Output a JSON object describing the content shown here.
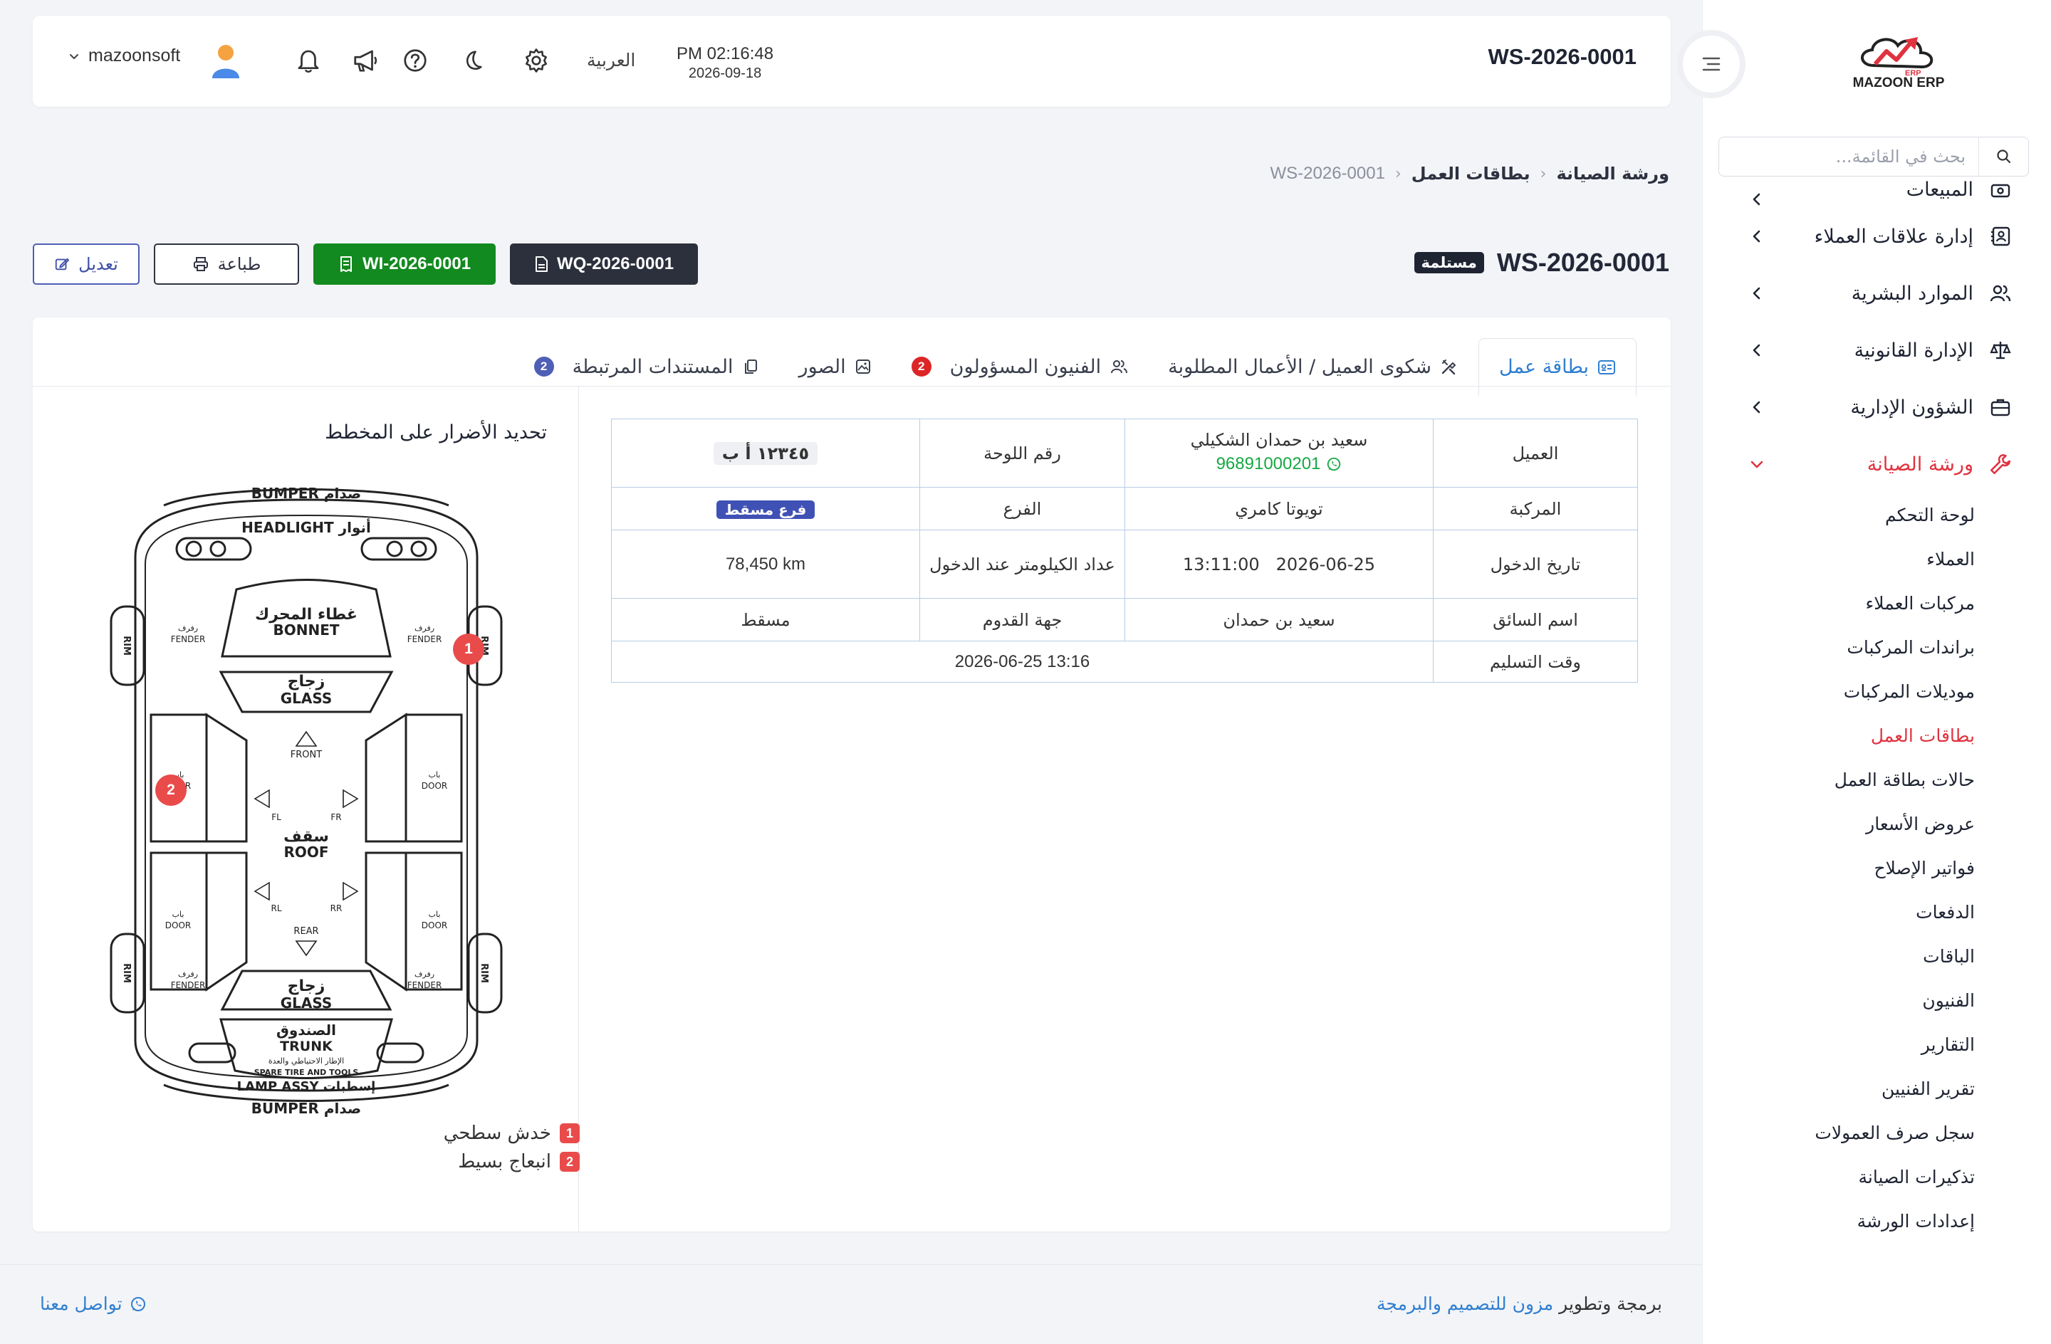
{
  "app": {
    "brand": "MAZOON ERP",
    "brand_tag": "ERP"
  },
  "topbar": {
    "doc_title": "WS-2026-0001",
    "time": "PM 02:16:48",
    "date": "2026-09-18",
    "language": "العربية",
    "username": "mazoonsoft"
  },
  "sidebar": {
    "search_placeholder": "بحث في القائمة...",
    "items": [
      {
        "label": "المبيعات",
        "icon": "cash-register-icon"
      },
      {
        "label": "إدارة علاقات العملاء",
        "icon": "contact-card-icon"
      },
      {
        "label": "الموارد البشرية",
        "icon": "users-icon"
      },
      {
        "label": "الإدارة القانونية",
        "icon": "scale-icon"
      },
      {
        "label": "الشؤون الإدارية",
        "icon": "briefcase-icon"
      },
      {
        "label": "ورشة الصيانة",
        "icon": "wrench-icon",
        "active": true
      }
    ],
    "sub_items": [
      "لوحة التحكم",
      "العملاء",
      "مركبات العملاء",
      "براندات المركبات",
      "موديلات المركبات",
      "بطاقات العمل",
      "حالات بطاقة العمل",
      "عروض الأسعار",
      "فواتير الإصلاح",
      "الدفعات",
      "الباقات",
      "الفنيون",
      "التقارير",
      "تقرير الفنيين",
      "سجل صرف العمولات",
      "تذكيرات الصيانة",
      "إعدادات الورشة"
    ],
    "active_sub": "بطاقات العمل"
  },
  "breadcrumb": {
    "root": "ورشة الصيانة",
    "section": "بطاقات العمل",
    "current": "WS-2026-0001"
  },
  "header": {
    "code": "WS-2026-0001",
    "status": "مستلمة"
  },
  "actions": {
    "edit": "تعديل",
    "print": "طباعة",
    "invoice": "WI-2026-0001",
    "quote": "WQ-2026-0001"
  },
  "tabs": [
    {
      "label": "بطاقة عمل",
      "icon": "id-card-icon",
      "active": true
    },
    {
      "label": "شكوى العميل / الأعمال المطلوبة",
      "icon": "tools-icon"
    },
    {
      "label": "الفنيون المسؤولون",
      "icon": "users-icon",
      "badge": "2",
      "badge_color": "#dc2626"
    },
    {
      "label": "الصور",
      "icon": "image-icon"
    },
    {
      "label": "المستندات المرتبطة",
      "icon": "copy-icon",
      "badge": "2",
      "badge_color": "#4f5fb5"
    }
  ],
  "card_info": {
    "customer_label": "العميل",
    "customer_name": "سعيد بن حمدان الشكيلي",
    "customer_phone": "96891000201",
    "plate_label": "رقم اللوحة",
    "plate_value": "١٢٣٤٥ أ ب",
    "vehicle_label": "المركبة",
    "vehicle_value": "تويوتا كامري",
    "branch_label": "الفرع",
    "branch_value": "فرع مسقط",
    "entry_label": "تاريخ الدخول",
    "entry_value": "2026-06-25   13:11:00",
    "odometer_label": "عداد الكيلومتر عند الدخول",
    "odometer_value": "78,450 km",
    "driver_label": "اسم السائق",
    "driver_value": "سعيد بن حمدان",
    "origin_label": "جهة القدوم",
    "origin_value": "مسقط",
    "delivery_label": "وقت التسليم",
    "delivery_value": "2026-06-25 13:16"
  },
  "damage": {
    "title": "تحديد الأضرار على المخطط",
    "labels": {
      "bumper": "BUMPER صدام",
      "headlight": "HEADLIGHT أنوار",
      "bonnet_ar": "غطاء المحرك",
      "bonnet": "BONNET",
      "glass_ar": "زجاج",
      "glass": "GLASS",
      "roof_ar": "سقف",
      "roof": "ROOF",
      "door": "DOOR",
      "door_ar": "باب",
      "fender": "FENDER",
      "fender_ar": "رفرف",
      "rim": "RIM",
      "trunk_ar": "الصندوق",
      "trunk": "TRUNK",
      "spare_ar": "الإطار الاحتياطي والعدة",
      "spare": "SPARE TIRE AND TOOLS",
      "lamp": "LAMP ASSY إسطبات",
      "front": "FRONT",
      "rear": "REAR",
      "fl": "FL",
      "fr": "FR",
      "rl": "RL",
      "rr": "RR"
    },
    "markers": [
      {
        "num": "1"
      },
      {
        "num": "2"
      }
    ],
    "legend": [
      {
        "num": "1",
        "label": "خدش سطحي"
      },
      {
        "num": "2",
        "label": "انبعاج بسيط"
      }
    ],
    "marker_color": "#e94b4b"
  },
  "footer": {
    "credit_prefix": "برمجة وتطوير",
    "credit_company": "مزون للتصميم والبرمجة",
    "contact": "تواصل معنا"
  }
}
